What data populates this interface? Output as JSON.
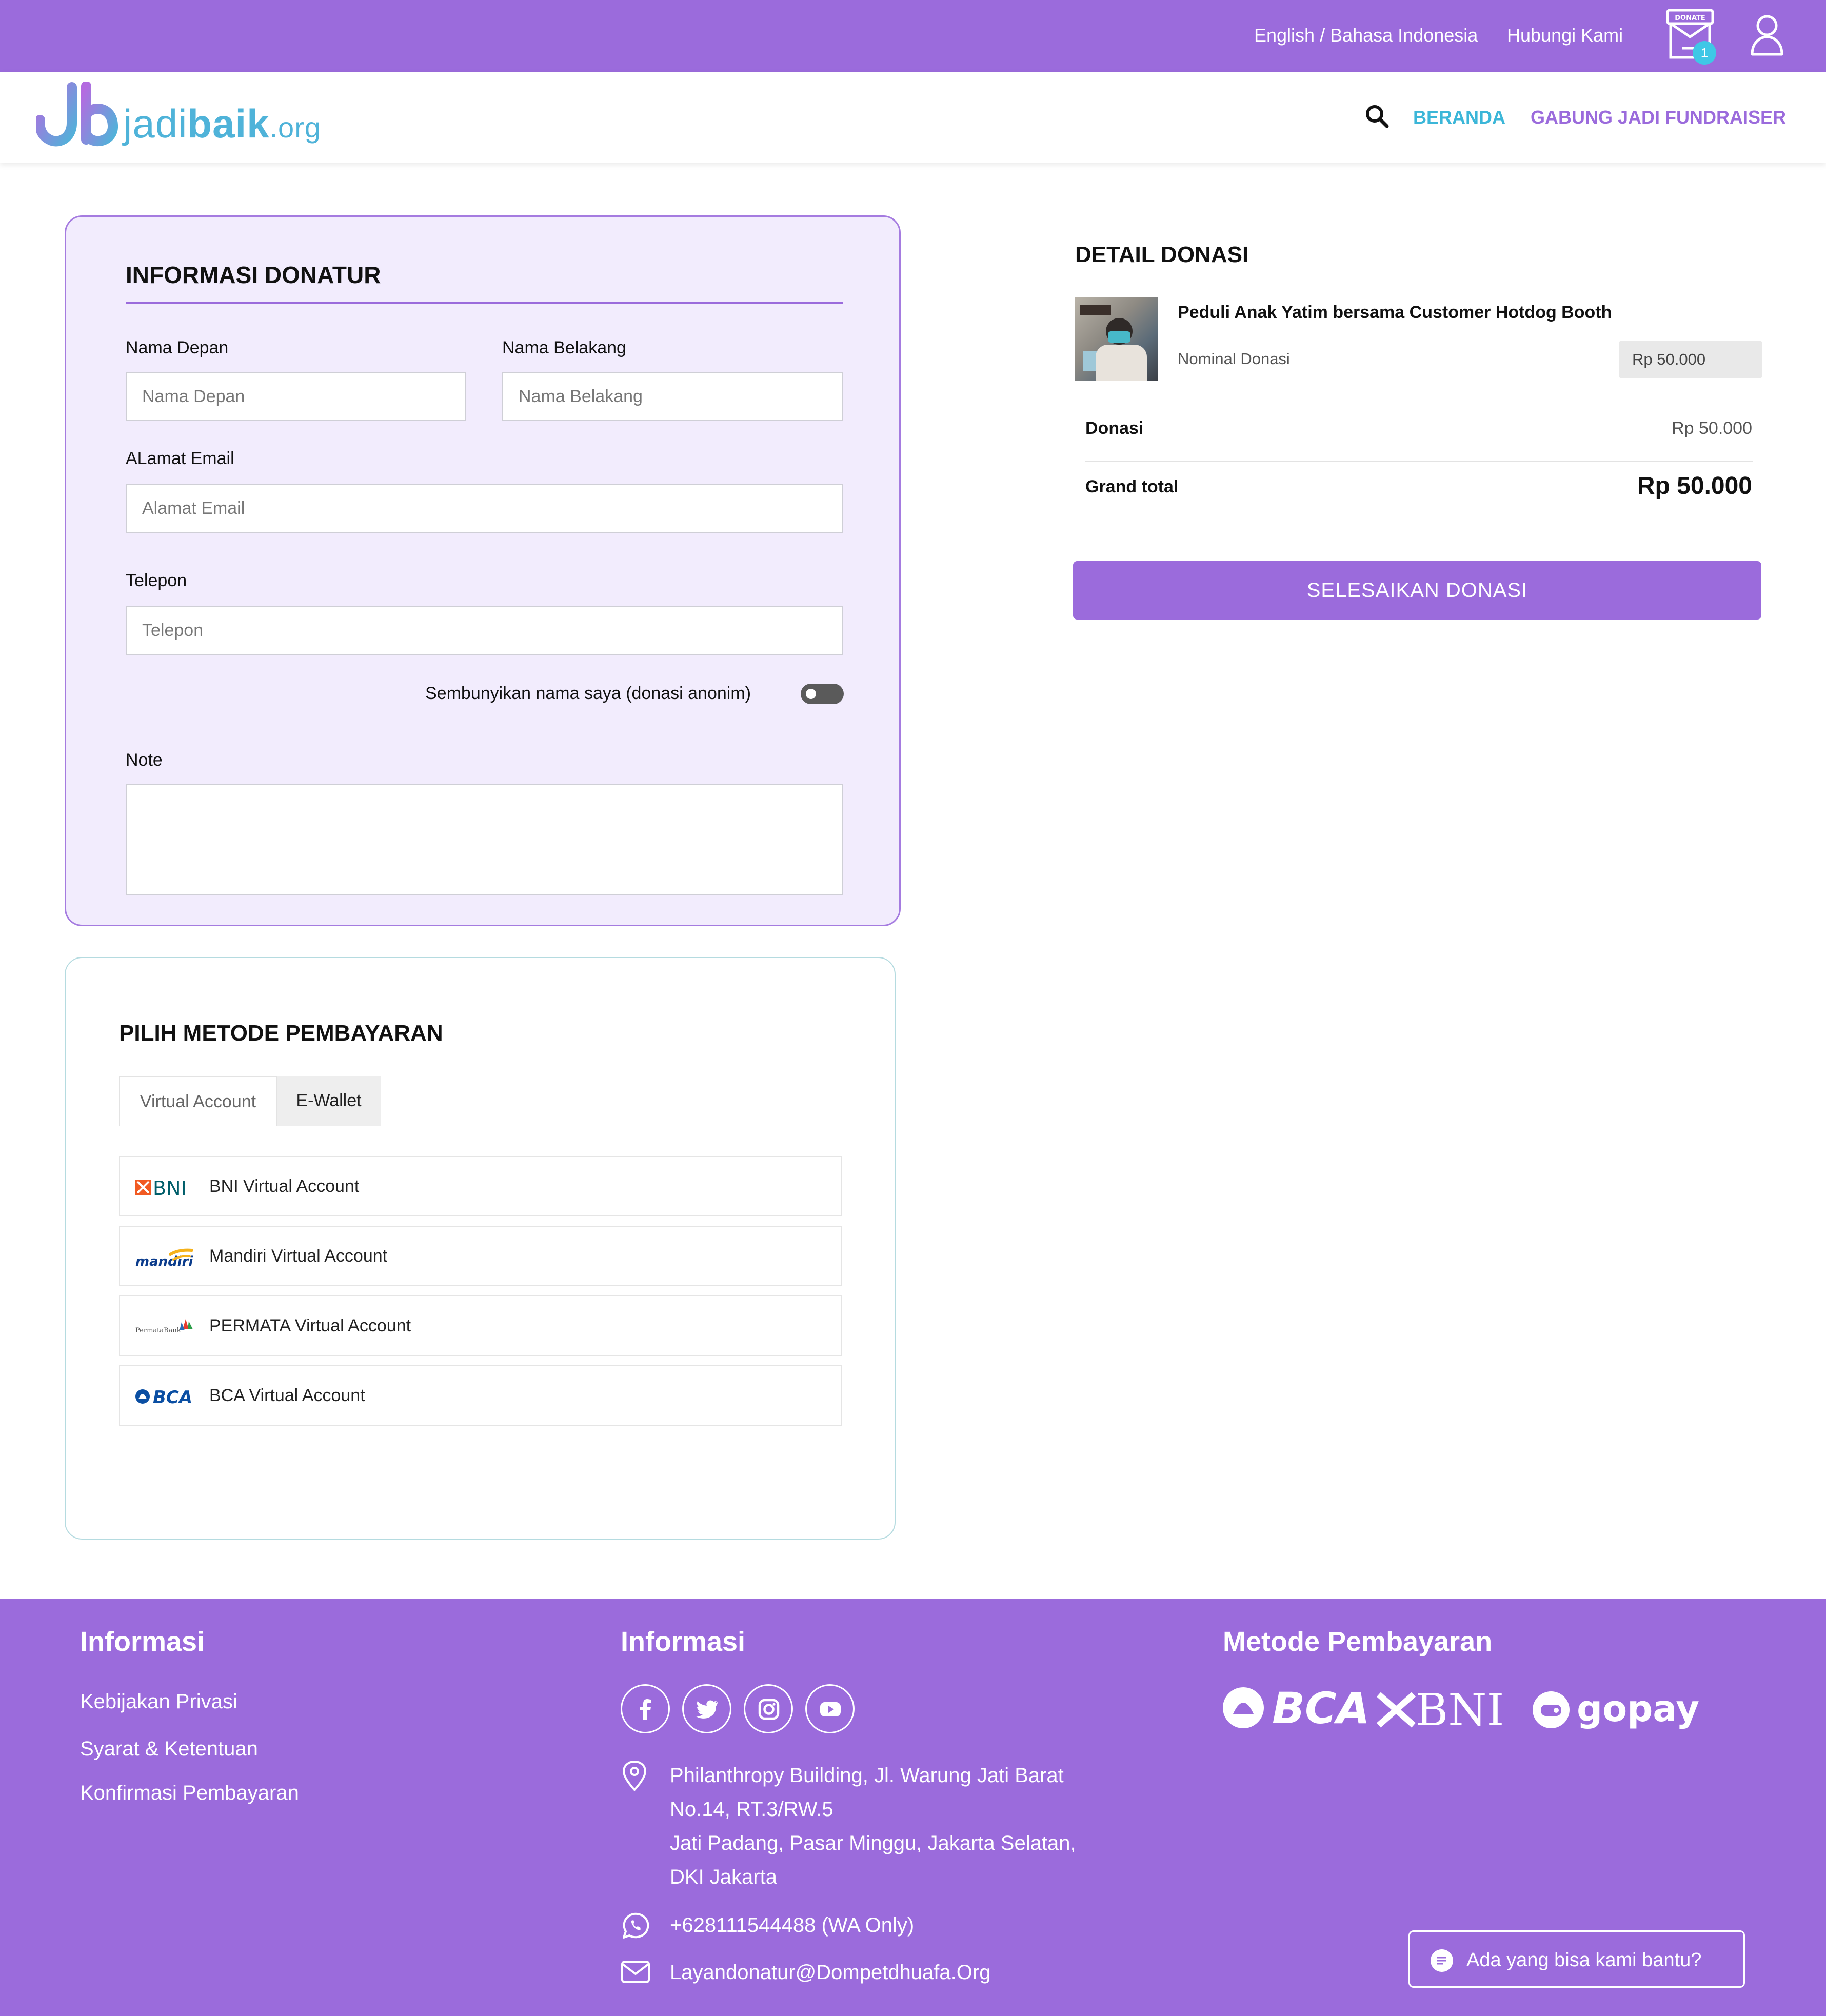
{
  "topbar": {
    "language": "English / Bahasa Indonesia",
    "contact": "Hubungi Kami",
    "donate_box_label": "DONATE",
    "cart_count": "1",
    "icons": {
      "donate": "donate-box-icon",
      "user": "user-icon"
    }
  },
  "navbar": {
    "logo_prefix": "jadi",
    "logo_bold": "baik",
    "logo_suffix": ".org",
    "home": "BERANDA",
    "fundraiser": "GABUNG JADI FUNDRAISER",
    "icons": {
      "search": "search-icon"
    }
  },
  "donor_form": {
    "title": "INFORMASI DONATUR",
    "first_name": {
      "label": "Nama Depan",
      "placeholder": "Nama Depan"
    },
    "last_name": {
      "label": "Nama Belakang",
      "placeholder": "Nama Belakang"
    },
    "email": {
      "label": "ALamat Email",
      "placeholder": "Alamat Email"
    },
    "phone": {
      "label": "Telepon",
      "placeholder": "Telepon"
    },
    "anonymous_label": "Sembunyikan nama saya (donasi anonim)",
    "anonymous_on": false,
    "note_label": "Note",
    "note_value": ""
  },
  "payment": {
    "title": "PILIH METODE PEMBAYARAN",
    "tabs": [
      "Virtual Account",
      "E-Wallet"
    ],
    "active_tab": "Virtual Account",
    "methods": [
      {
        "label": "BNI Virtual Account",
        "logo_text": "BNI"
      },
      {
        "label": "Mandiri Virtual Account",
        "logo_text": "mandiri"
      },
      {
        "label": "PERMATA Virtual Account",
        "logo_text": "PermataBank"
      },
      {
        "label": "BCA Virtual Account",
        "logo_text": "BCA"
      }
    ]
  },
  "detail": {
    "title": "DETAIL DONASI",
    "campaign": "Peduli Anak Yatim bersama Customer Hotdog Booth",
    "nominal_label": "Nominal Donasi",
    "nominal_value": "Rp 50.000",
    "donasi_label": "Donasi",
    "donasi_value": "Rp 50.000",
    "total_label": "Grand total",
    "total_value": "Rp 50.000",
    "finish_button": "SELESAIKAN DONASI"
  },
  "footer": {
    "col1_title": "Informasi",
    "links": [
      "Kebijakan Privasi",
      "Syarat & Ketentuan",
      "Konfirmasi Pembayaran"
    ],
    "col2_title": "Informasi",
    "address_lines": [
      "Philanthropy Building, Jl. Warung Jati Barat",
      "No.14, RT.3/RW.5",
      "Jati Padang, Pasar Minggu, Jakarta Selatan,",
      "DKI Jakarta"
    ],
    "phone": "+628111544488 (WA Only)",
    "email": "Layandonatur@Dompetdhuafa.Org",
    "col3_title": "Metode Pembayaran",
    "payment_logos": [
      "BCA",
      "BNI",
      "gopay"
    ],
    "help_button": "Ada yang bisa kami bantu?",
    "social_icons": [
      "facebook-icon",
      "twitter-icon",
      "instagram-icon",
      "youtube-icon"
    ]
  },
  "colors": {
    "primary": "#9b6bdc",
    "accent": "#3bb6d8",
    "form_bg": "#f2ecfd"
  }
}
